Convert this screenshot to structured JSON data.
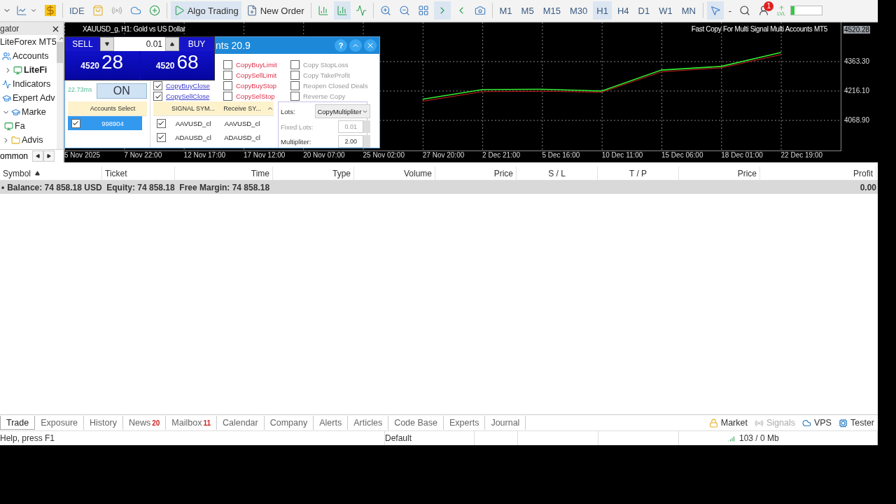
{
  "toolbar": {
    "ide": "IDE",
    "algo_trading": {
      "label": "Algo Trading",
      "on": true
    },
    "new_order": "New Order",
    "timeframes": [
      {
        "label": "M1",
        "selected": false
      },
      {
        "label": "M5",
        "selected": false
      },
      {
        "label": "M15",
        "selected": false
      },
      {
        "label": "M30",
        "selected": false
      },
      {
        "label": "H1",
        "selected": true
      },
      {
        "label": "H4",
        "selected": false
      },
      {
        "label": "D1",
        "selected": false
      },
      {
        "label": "W1",
        "selected": false
      },
      {
        "label": "MN",
        "selected": false
      }
    ],
    "dash": "-",
    "notification_count": "1",
    "level_label": "LVL"
  },
  "navigator": {
    "title": "gator",
    "items": [
      {
        "label": "LiteForex MT5",
        "children": [
          {
            "label": "Accounts",
            "children": [
              {
                "label": "LiteFi",
                "expanded": false
              }
            ]
          },
          {
            "label": "Indicators"
          },
          {
            "label": "Expert Adv"
          },
          {
            "label": "Marke",
            "expanded": true,
            "children": [
              {
                "label": "Fa"
              }
            ]
          },
          {
            "label": "Advis",
            "expanded": false
          }
        ]
      }
    ],
    "tab": "ommon"
  },
  "chart": {
    "title": "XAUUSD_g, H1:  Gold vs US Dollar",
    "expert_name": "Fast Copy For Multi Signal Multi Accounts MT5",
    "current_price": "4520.28",
    "chart_data": {
      "type": "line",
      "categories": [
        "5 Nov 2025",
        "7 Nov 22:00",
        "12 Nov 17:00",
        "17 Nov 12:00",
        "20 Nov 07:00",
        "25 Nov 02:00",
        "27 Nov 20:00",
        "2 Dec 21:00",
        "5 Dec 16:00",
        "10 Dec 11:00",
        "15 Dec 06:00",
        "18 Dec 01:00",
        "22 Dec 19:00"
      ],
      "series": [
        {
          "color": "#33ee33",
          "values": [
            null,
            null,
            null,
            null,
            null,
            null,
            4175,
            4223,
            4225,
            4216,
            4321,
            4339,
            4409
          ]
        },
        {
          "color": "#d02020",
          "values": [
            null,
            null,
            null,
            null,
            null,
            null,
            4165,
            4213,
            4215,
            4210,
            4312,
            4332,
            4398
          ]
        }
      ],
      "grid": true,
      "ylim": [
        3914.7,
        4559.6
      ],
      "yticks": [
        {
          "value": 4363.3,
          "label": "4363.30"
        },
        {
          "value": 4216.1,
          "label": "4216.10"
        },
        {
          "value": 4068.9,
          "label": "4068.90"
        }
      ]
    }
  },
  "one_click": {
    "sell": "SELL",
    "buy": "BUY",
    "lot": "0.01",
    "sell_price": {
      "big": "4520",
      "small": "28"
    },
    "buy_price": {
      "big": "4520",
      "small": "68"
    }
  },
  "dialog": {
    "title": "nts 20.9",
    "help": "?",
    "latency": "22.73ms",
    "power_button": "ON",
    "option_columns": [
      [
        {
          "label": "CopyBuyClose",
          "kind": "link",
          "checked": true
        },
        {
          "label": "CopySellClose",
          "kind": "link",
          "checked": true
        }
      ],
      [
        {
          "label": "CopyBuyLimit",
          "kind": "pending",
          "checked": false
        },
        {
          "label": "CopySellLimit",
          "kind": "pending",
          "checked": false
        },
        {
          "label": "CopyBuyStop",
          "kind": "pending",
          "checked": false
        },
        {
          "label": "CopySelStop",
          "kind": "pending",
          "checked": false
        }
      ],
      [
        {
          "label": "Copy StopLoss",
          "kind": "extra",
          "checked": false
        },
        {
          "label": "Copy TakeProfit",
          "kind": "extra",
          "checked": false
        },
        {
          "label": "Reopen Closed Deals",
          "kind": "extra",
          "checked": false
        },
        {
          "label": "Reverse Copy",
          "kind": "extra",
          "checked": false
        }
      ]
    ],
    "accounts": {
      "header": "Accounts Select",
      "rows": [
        {
          "account": "998904",
          "checked": true,
          "selected": true
        }
      ]
    },
    "signals": {
      "columns": [
        "SIGNAL SYM...",
        "Receive SY..."
      ],
      "rows": [
        {
          "signal": "AAVUSD_cl",
          "receive": "AAVUSD_cl",
          "checked": true
        },
        {
          "signal": "ADAUSD_cl",
          "receive": "ADAUSD_cl",
          "checked": true
        }
      ]
    },
    "lots": {
      "label": "Lots:",
      "mode": "CopyMultipliter",
      "fixed_label": "Fixed Lots:",
      "fixed_value": "0.01",
      "fixed_disabled": true,
      "multiplier_label": "Multipliter:",
      "multiplier_value": "2.00"
    }
  },
  "trade": {
    "columns": [
      {
        "label": "Symbol",
        "sorted": true
      },
      {
        "label": "Ticket",
        "sorted": false
      },
      {
        "label": "Time",
        "sorted": false
      },
      {
        "label": "Type",
        "sorted": false
      },
      {
        "label": "Volume",
        "sorted": false
      },
      {
        "label": "Price",
        "sorted": false
      },
      {
        "label": "S / L",
        "sorted": false
      },
      {
        "label": "T / P",
        "sorted": false
      },
      {
        "label": "Price",
        "sorted": false
      },
      {
        "label": "Profit",
        "sorted": false
      }
    ],
    "balance_marker": "•",
    "balance": "Balance: 74 858.18 USD  Equity: 74 858.18  Free Margin: 74 858.18",
    "profit": "0.00"
  },
  "bottom_tabs": [
    {
      "label": "Trade",
      "selected": true
    },
    {
      "label": "Exposure",
      "selected": false
    },
    {
      "label": "History",
      "selected": false
    },
    {
      "label": "News",
      "badge": "20",
      "selected": false
    },
    {
      "label": "Mailbox",
      "badge": "11",
      "selected": false
    },
    {
      "label": "Calendar",
      "selected": false
    },
    {
      "label": "Company",
      "selected": false
    },
    {
      "label": "Alerts",
      "selected": false
    },
    {
      "label": "Articles",
      "selected": false
    },
    {
      "label": "Code Base",
      "selected": false
    },
    {
      "label": "Experts",
      "selected": false
    },
    {
      "label": "Journal",
      "selected": false
    }
  ],
  "services": [
    {
      "label": "Market",
      "kind": "market",
      "disabled": false
    },
    {
      "label": "Signals",
      "kind": "signals",
      "disabled": true
    },
    {
      "label": "VPS",
      "kind": "vps",
      "disabled": false
    },
    {
      "label": "Tester",
      "kind": "tester",
      "disabled": false
    }
  ],
  "status_bar": {
    "help": "Help, press F1",
    "profile": "Default",
    "traffic": "103 / 0 Mb"
  }
}
